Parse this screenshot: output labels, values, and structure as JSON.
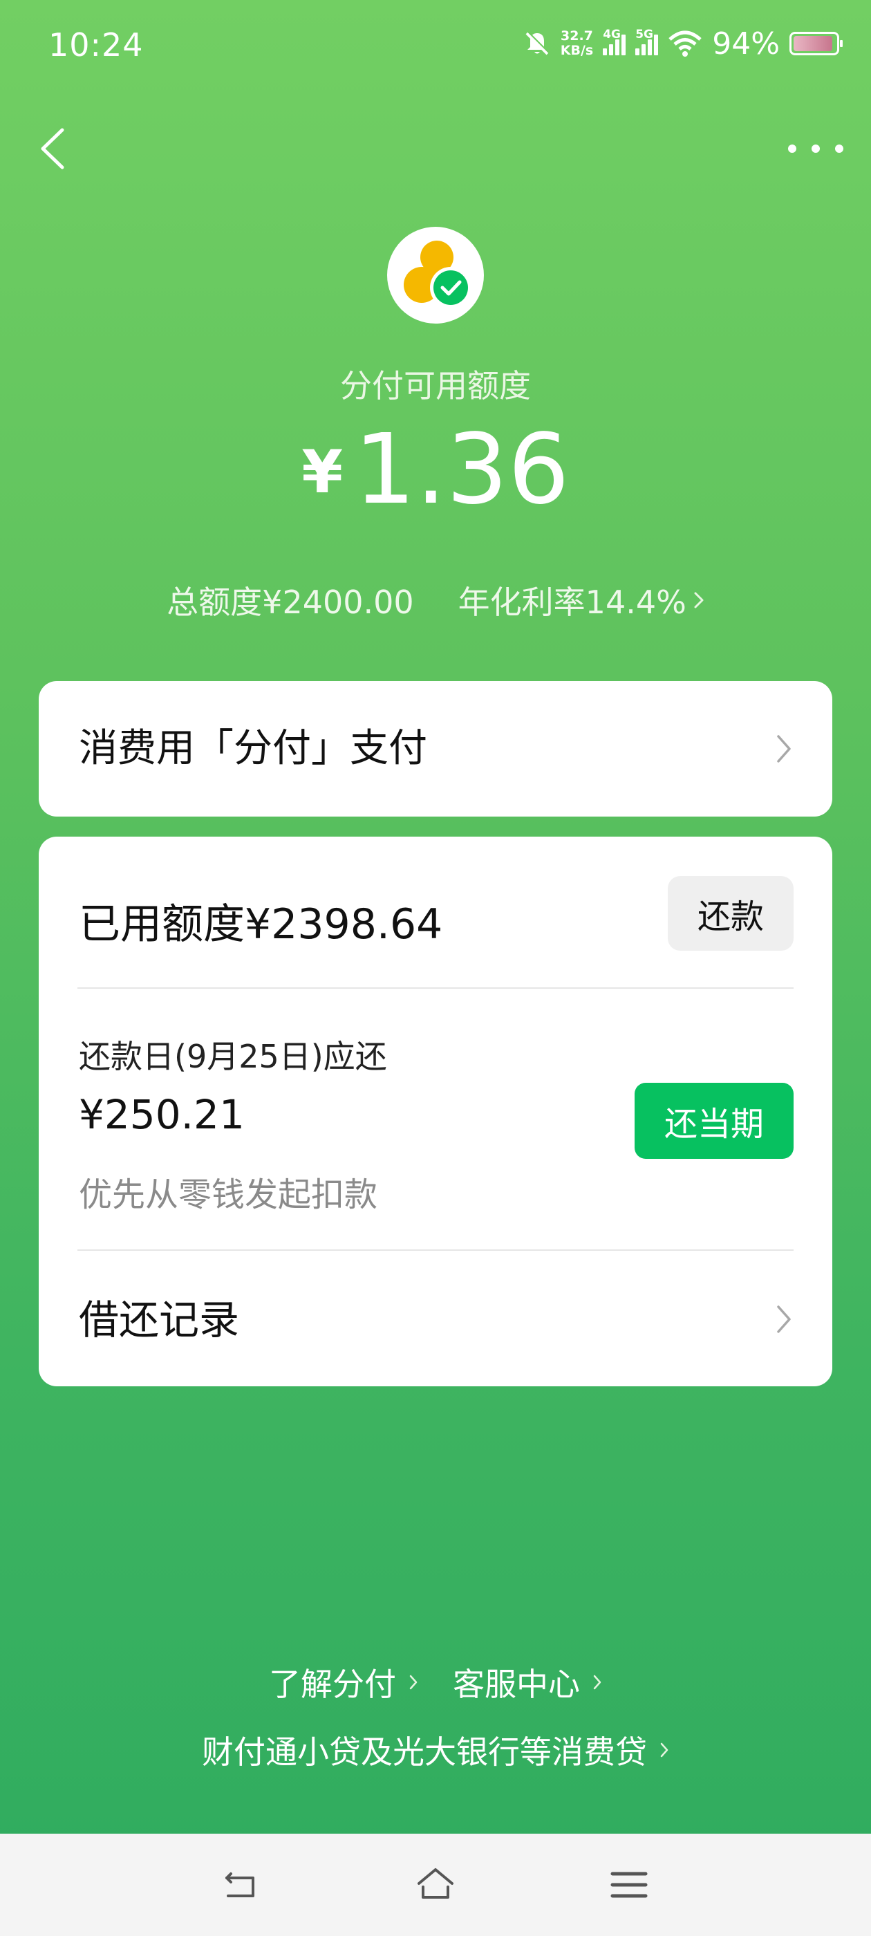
{
  "status_bar": {
    "time": "10:24",
    "net_speed_value": "32.7",
    "net_speed_unit": "KB/s",
    "sim1_tag": "4G",
    "sim2_tag": "5G",
    "battery_percent": "94%",
    "battery_level": 0.94
  },
  "header": {
    "back_icon": "chevron-left-icon",
    "more_icon": "more-dots-icon"
  },
  "summary": {
    "available_label": "分付可用额度",
    "currency_symbol": "¥",
    "available_amount": "1.36",
    "total_limit": "总额度¥2400.00",
    "annual_rate": "年化利率14.4%"
  },
  "pay_card": {
    "label": "消费用「分付」支付"
  },
  "main_card": {
    "used_limit": "已用额度¥2398.64",
    "repay_button": "还款",
    "due_label": "还款日(9月25日)应还",
    "due_amount": "¥250.21",
    "due_note": "优先从零钱发起扣款",
    "repay_current_button": "还当期",
    "history_label": "借还记录"
  },
  "footer": {
    "learn_link": "了解分付",
    "service_link": "客服中心",
    "lender_link": "财付通小贷及光大银行等消费贷"
  },
  "colors": {
    "bg_top": "#72CF63",
    "bg_bottom": "#2EAB5F",
    "wechat_green": "#07C160",
    "logo_yellow": "#F5B800"
  }
}
